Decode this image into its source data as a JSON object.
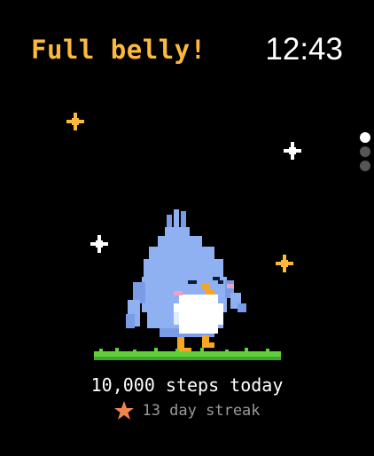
{
  "header": {
    "status_text": "Full belly!",
    "time": "12:43"
  },
  "pager": {
    "total_pages": 3,
    "active_page": 1
  },
  "pet": {
    "icon": "bird-pet-icon"
  },
  "stats": {
    "steps_text": "10,000 steps today",
    "streak_text": "13 day streak",
    "streak_icon": "star-icon"
  },
  "colors": {
    "background": "#000000",
    "status_text": "#FDB93B",
    "time_text": "#FFFFFF",
    "steps_text": "#FFFFFF",
    "streak_text": "#9A9A9A",
    "streak_star": "#F0844A",
    "sparkle_gold": "#FDB93B",
    "sparkle_white": "#FFFFFF",
    "grass": "#5FD03A",
    "pet_body": "#8FB1F2",
    "pet_belly": "#FFFFFF",
    "pet_beak": "#F6A623"
  }
}
